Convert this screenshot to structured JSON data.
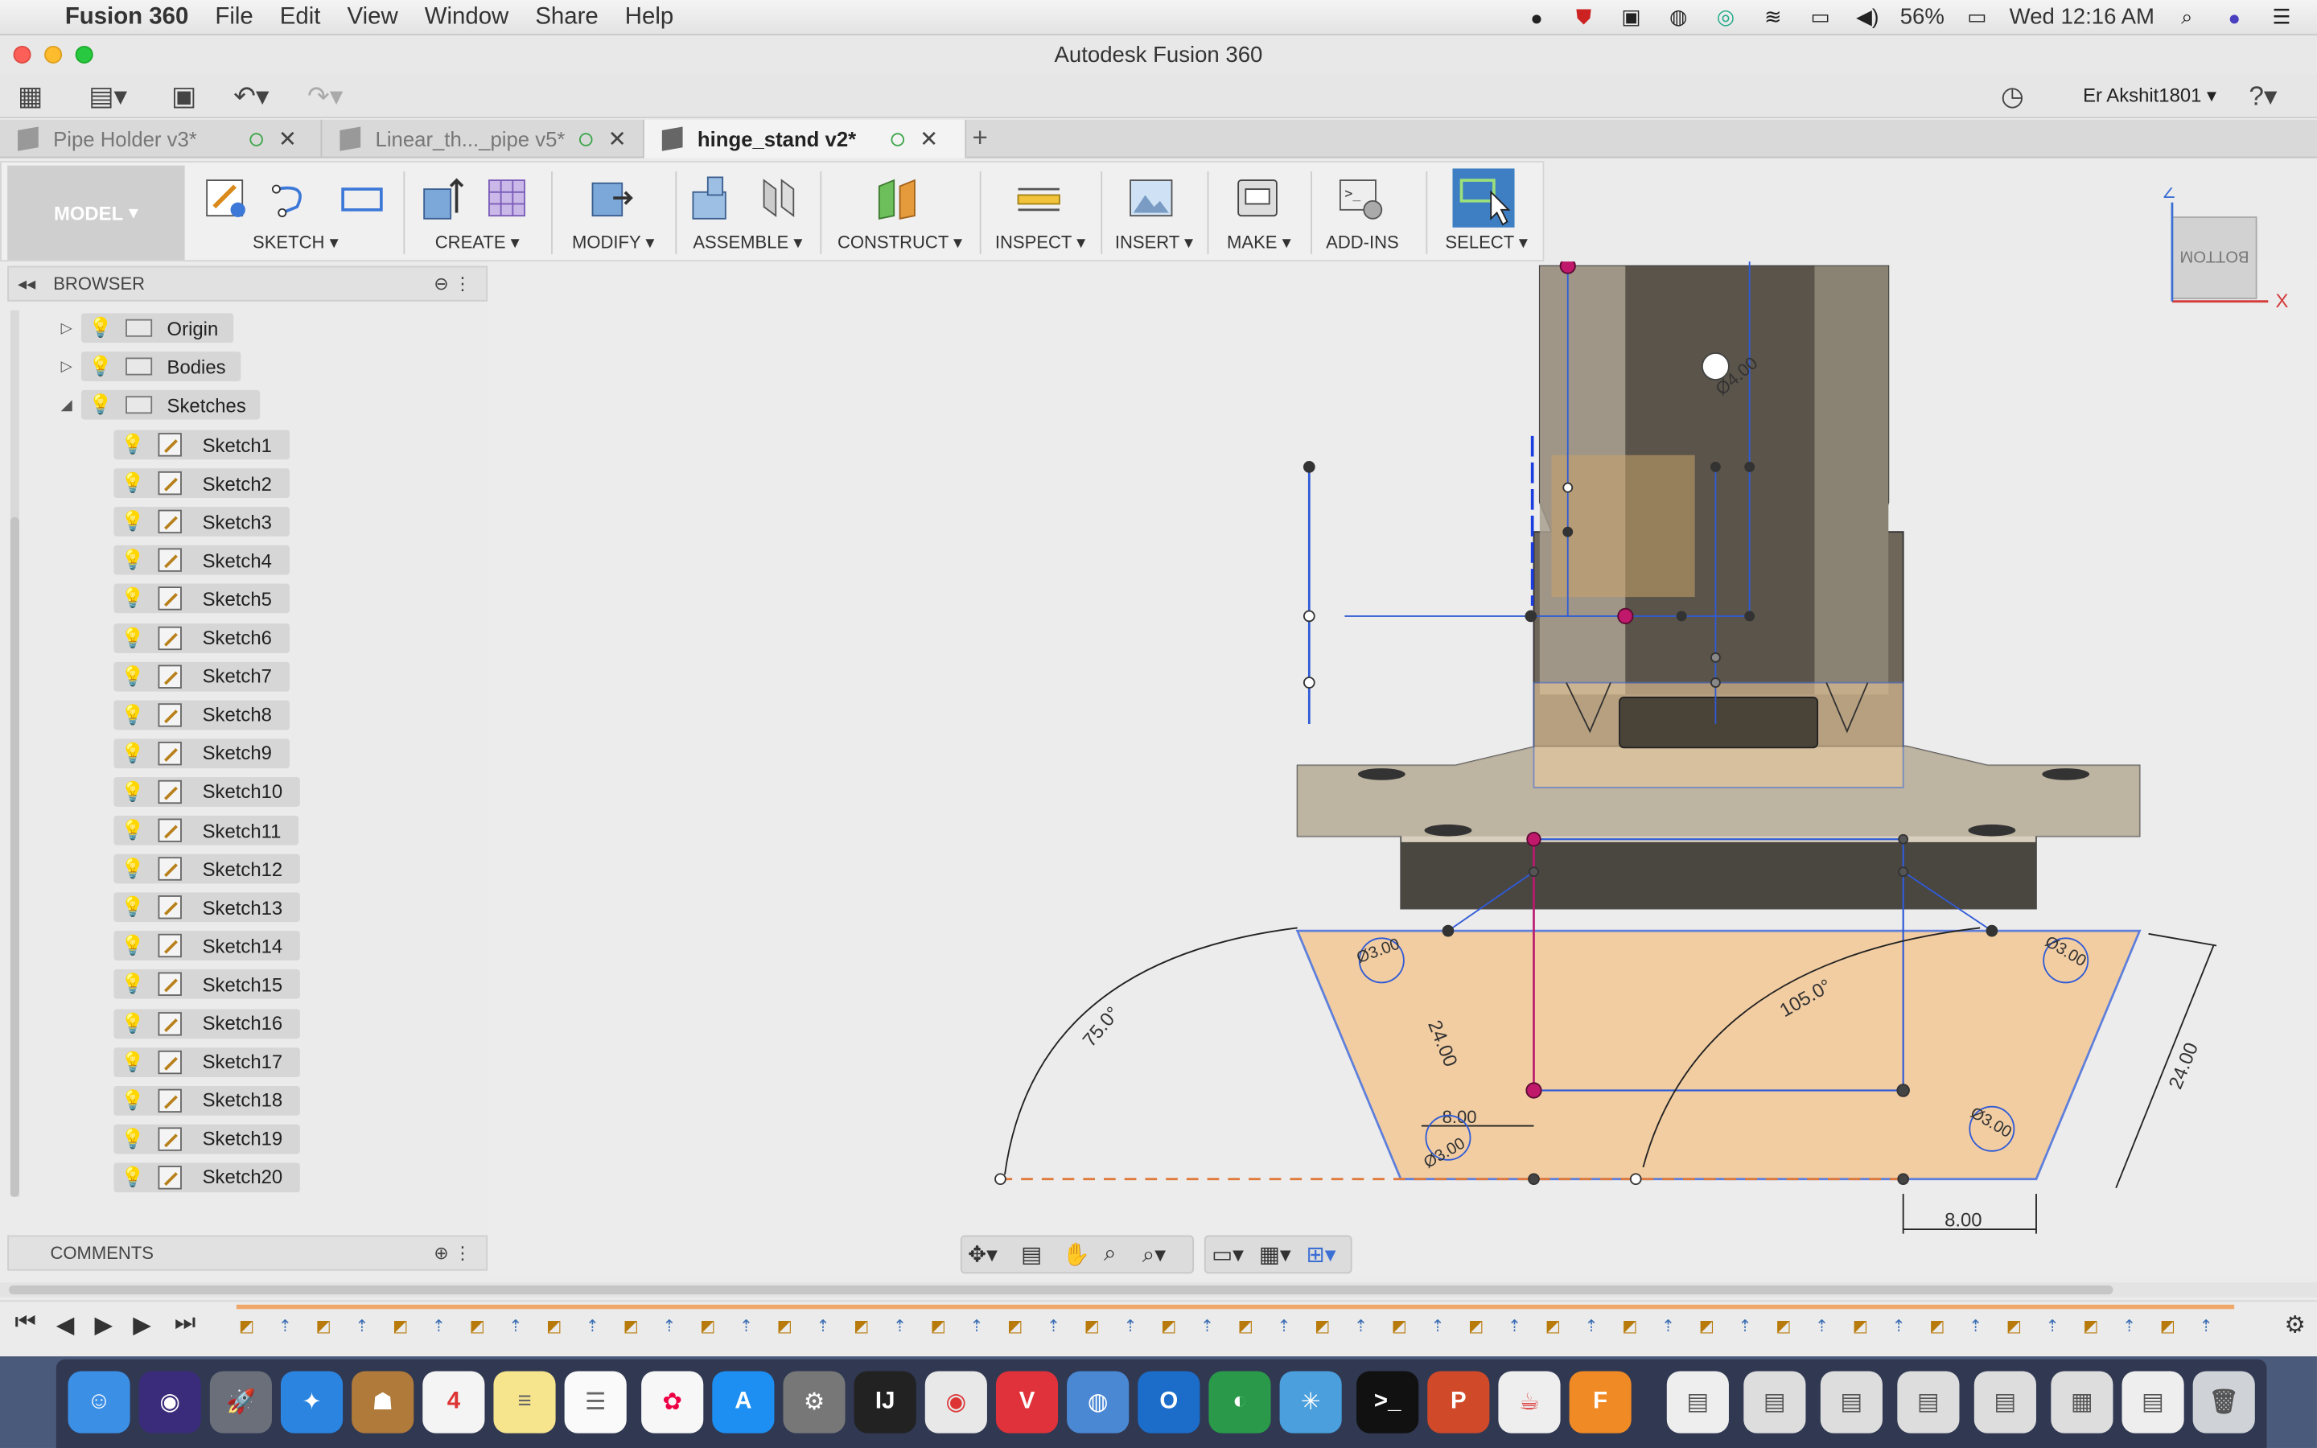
{
  "menubar": {
    "app": "Fusion 360",
    "items": [
      "File",
      "Edit",
      "View",
      "Window",
      "Share",
      "Help"
    ],
    "battery": "56%",
    "clock": "Wed 12:16 AM"
  },
  "window": {
    "title": "Autodesk Fusion 360"
  },
  "user": {
    "name": "Er Akshit1801"
  },
  "tabs": [
    {
      "label": "Pipe Holder v3*"
    },
    {
      "label": "Linear_th..._pipe v5*"
    },
    {
      "label": "hinge_stand v2*"
    }
  ],
  "toolbar": {
    "workspace": "MODEL",
    "groups": [
      "SKETCH",
      "CREATE",
      "MODIFY",
      "ASSEMBLE",
      "CONSTRUCT",
      "INSPECT",
      "INSERT",
      "MAKE",
      "ADD-INS",
      "SELECT"
    ]
  },
  "browser": {
    "title": "BROWSER",
    "folders": [
      "Origin",
      "Bodies",
      "Sketches"
    ],
    "sketches": [
      "Sketch1",
      "Sketch2",
      "Sketch3",
      "Sketch4",
      "Sketch5",
      "Sketch6",
      "Sketch7",
      "Sketch8",
      "Sketch9",
      "Sketch10",
      "Sketch11",
      "Sketch12",
      "Sketch13",
      "Sketch14",
      "Sketch15",
      "Sketch16",
      "Sketch17",
      "Sketch18",
      "Sketch19",
      "Sketch20"
    ]
  },
  "comments": {
    "title": "COMMENTS"
  },
  "viewcube": {
    "face": "BOTTOM",
    "axis_z": "Z",
    "axis_x": "X"
  },
  "dimensions": {
    "angle_left": "75.0°",
    "angle_right": "105.0°",
    "len_left": "24.00",
    "len_right": "24.00",
    "width_small": "8.00",
    "width_bottom": "8.00",
    "dia_top": "Ø4.00",
    "dia_hole": "Ø3.00"
  },
  "colors": {
    "sketch_fill": "#f5c38a",
    "sketch_line": "#2f5bd6",
    "body": "#8a7f70",
    "accent_magenta": "#c0186a"
  }
}
